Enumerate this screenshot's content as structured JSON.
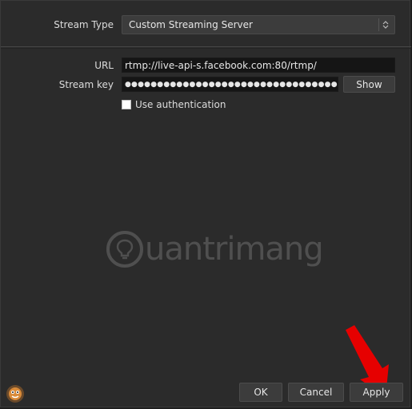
{
  "stream": {
    "type_label": "Stream Type",
    "type_value": "Custom Streaming Server",
    "url_label": "URL",
    "url_value": "rtmp://live-api-s.facebook.com:80/rtmp/",
    "key_label": "Stream key",
    "key_value": "●●●●●●●●●●●●●●●●●●●●●●●●●●●●●●●●●●●●●",
    "show_label": "Show",
    "auth_label": "Use authentication",
    "auth_checked": false
  },
  "watermark": {
    "text": "uantrimang"
  },
  "footer": {
    "ok_label": "OK",
    "cancel_label": "Cancel",
    "apply_label": "Apply"
  },
  "colors": {
    "background": "#2b2b2b",
    "input_bg": "#151515",
    "button_bg": "#3c3c3c",
    "arrow": "#e60000"
  },
  "icons": {
    "combo": "updown-chevron-icon",
    "app": "obs-app-icon",
    "annotation": "red-arrow-icon"
  }
}
